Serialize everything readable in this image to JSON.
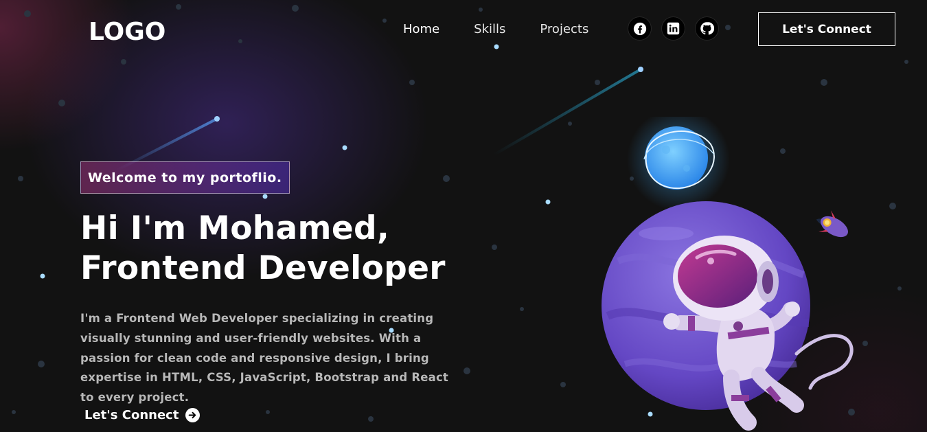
{
  "header": {
    "logo": "LOGO",
    "nav": [
      {
        "label": "Home",
        "active": true
      },
      {
        "label": "Skills",
        "active": false
      },
      {
        "label": "Projects",
        "active": false
      }
    ],
    "socials": [
      {
        "icon": "facebook-icon"
      },
      {
        "icon": "linkedin-icon"
      },
      {
        "icon": "github-icon"
      }
    ],
    "connect_label": "Let's Connect"
  },
  "hero": {
    "tagline": "Welcome to my portoflio.",
    "headline_line1": "Hi I'm Mohamed,",
    "headline_line2": "Frontend Developer",
    "description": "I'm a Frontend Web Developer specializing in creating visually stunning and user-friendly websites. With a passion for clean code and responsive design, I bring expertise in HTML, CSS, JavaScript, Bootstrap and React to every project.",
    "cta_label": "Let's Connect",
    "cta_icon": "arrow-right-circle-icon"
  },
  "colors": {
    "background": "#121212",
    "tagline_gradient_start": "#aa367c",
    "tagline_gradient_end": "#4a2fbd",
    "planet": "#6a4fc9",
    "moon": "#3fa9f5"
  }
}
